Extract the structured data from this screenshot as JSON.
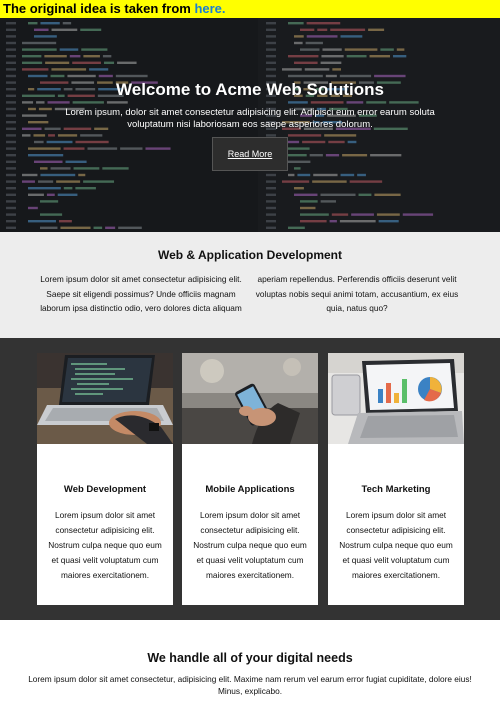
{
  "notice": {
    "text": "The original idea is taken from ",
    "link": "here."
  },
  "hero": {
    "title": "Welcome to Acme Web Solutions",
    "text": "Lorem ipsum, dolor sit amet consectetur adipisicing elit. Adipisci eum error earum soluta voluptatum nisi laboriosam eos saepe asperiores dolorum.",
    "button": "Read More"
  },
  "intro": {
    "title": "Web & Application Development",
    "left": "Lorem ipsum dolor sit amet consectetur adipisicing elit. Saepe sit eligendi possimus? Unde officiis magnam laborum ipsa distinctio odio, vero dolores dicta aliquam",
    "right": "aperiam repellendus. Perferendis officiis deserunt velit voluptas nobis sequi animi totam, accusantium, ex eius quia, natus quo?"
  },
  "cards": [
    {
      "title": "Web Development",
      "text": "Lorem ipsum dolor sit amet consectetur adipisicing elit. Nostrum culpa neque quo eum et quasi velit voluptatum cum maiores exercitationem.",
      "image": "laptop-coding-image"
    },
    {
      "title": "Mobile Applications",
      "text": "Lorem ipsum dolor sit amet consectetur adipisicing elit. Nostrum culpa neque quo eum et quasi velit voluptatum cum maiores exercitationem.",
      "image": "phone-in-hand-image"
    },
    {
      "title": "Tech Marketing",
      "text": "Lorem ipsum dolor sit amet consectetur adipisicing elit. Nostrum culpa neque quo eum et quasi velit voluptatum cum maiores exercitationem.",
      "image": "laptop-charts-image"
    }
  ],
  "bottom": {
    "title": "We handle all of your digital needs",
    "text": "Lorem ipsum dolor sit amet consectetur, adipisicing elit. Maxime nam rerum vel earum error fugiat cupiditate, dolore eius! Minus, explicabo."
  },
  "colors": {
    "notice_bg": "#ffff00",
    "link": "#1a7fd4",
    "dark_section": "#333333",
    "light_section": "#ededed"
  }
}
